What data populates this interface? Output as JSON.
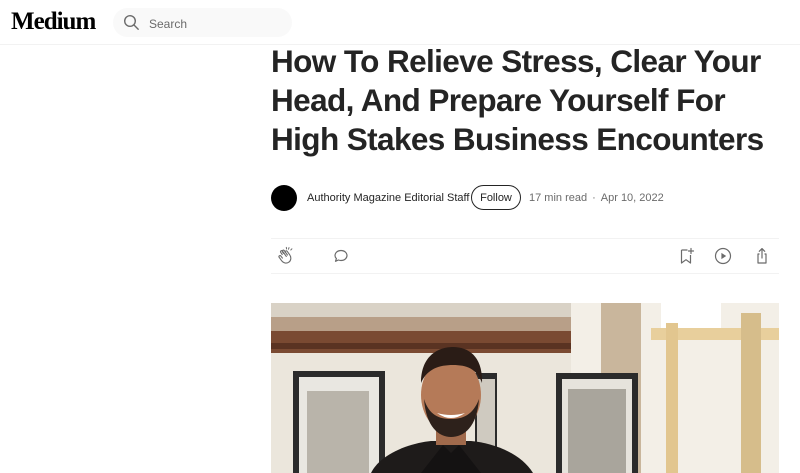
{
  "header": {
    "logo": "Medium",
    "search": {
      "placeholder": "Search"
    }
  },
  "article": {
    "title": "How To Relieve Stress, Clear Your Head, And Prepare Yourself For High Stakes Business Encounters",
    "author": "Authority Magazine Editorial Staff",
    "follow_label": "Follow",
    "read_time": "17 min read",
    "separator": "·",
    "date": "Apr 10, 2022"
  },
  "actions": {
    "icons": [
      "clap-icon",
      "comment-icon",
      "bookmark-icon",
      "play-icon",
      "share-icon"
    ]
  },
  "colors": {
    "text": "#242424",
    "muted": "#6b6b6b",
    "search_bg": "#f9f9f9",
    "divider": "#f2f2f2"
  }
}
